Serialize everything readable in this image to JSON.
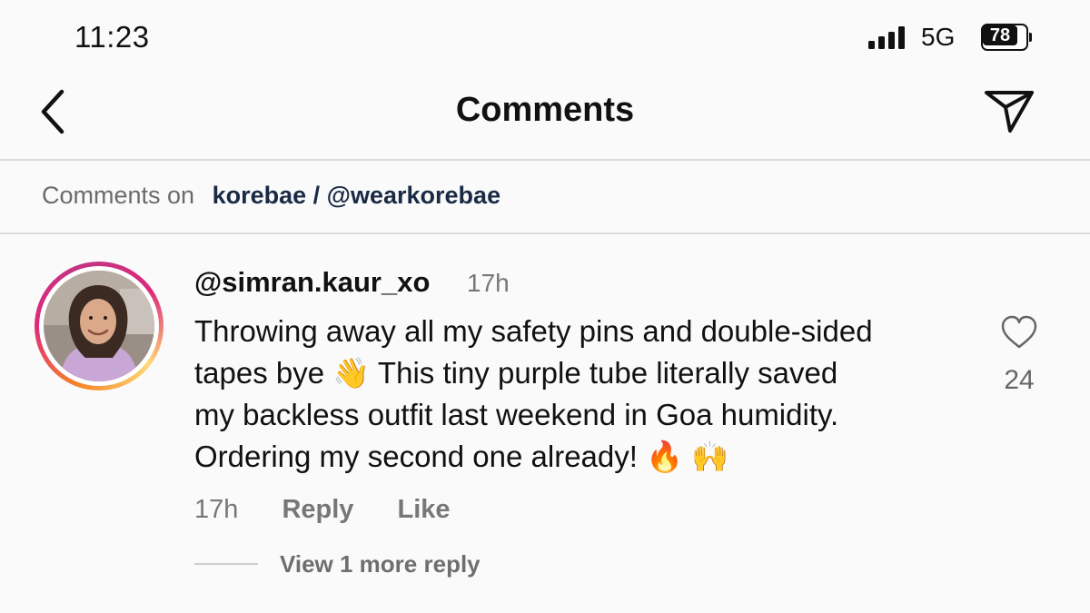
{
  "status_bar": {
    "time": "11:23",
    "network": "5G",
    "battery": "78"
  },
  "header": {
    "title": "Comments",
    "back_icon": "chevron-left-icon",
    "share_icon": "paper-plane-icon"
  },
  "context": {
    "prefix": "Comments on",
    "account": "korebae / @wearkorebae"
  },
  "comment": {
    "username": "@simran.kaur_xo",
    "time": "17h",
    "text_line1": "Throwing away all my safety pins and double-sided",
    "text_line2": "tapes bye 👋 This tiny purple tube literally saved",
    "text_line3": "my backless outfit last weekend in Goa humidity.",
    "text_line4": "Ordering my second one already! 🔥 🙌",
    "like_count": "24",
    "actions": {
      "time": "17h",
      "reply": "Reply",
      "like": "Like"
    },
    "view_more": "View 1 more reply"
  },
  "colors": {
    "background": "#fafafa",
    "text": "#111111",
    "muted": "#777777",
    "account": "#1a2a44",
    "divider": "#dcdcdc"
  }
}
